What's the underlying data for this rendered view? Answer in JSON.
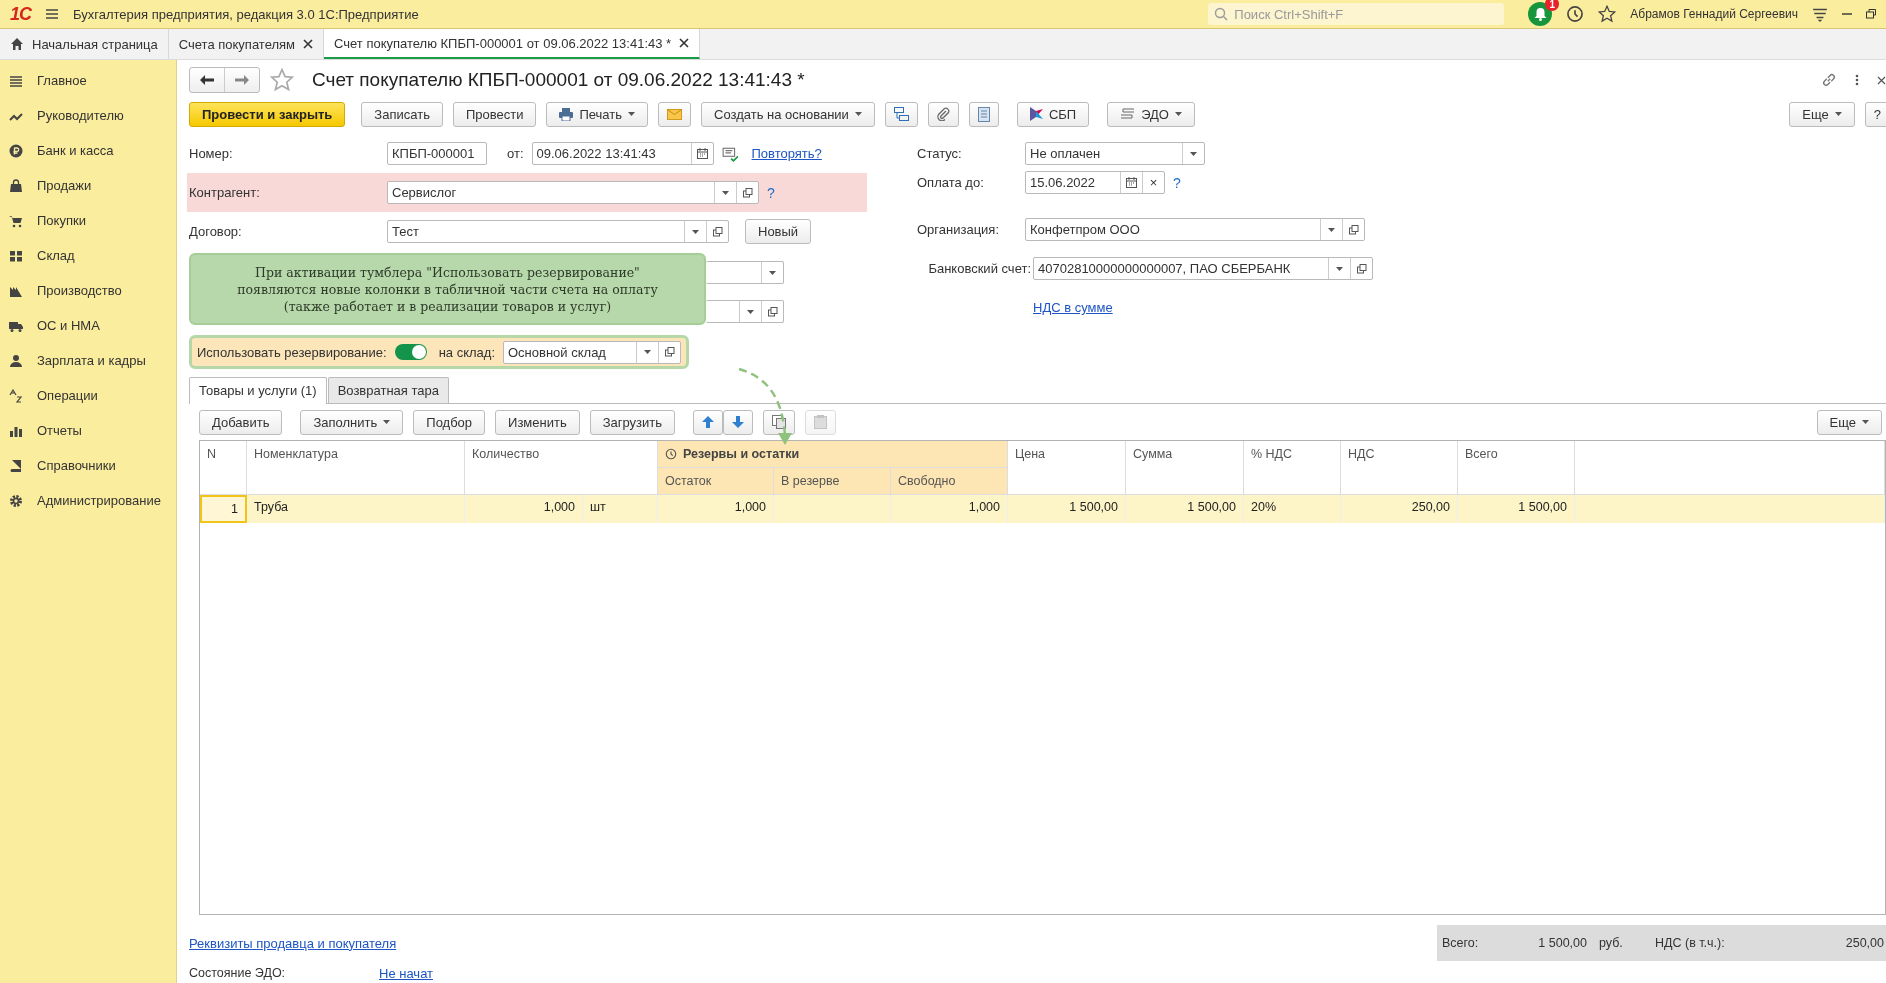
{
  "app_bar": {
    "logo": "1С",
    "title": "Бухгалтерия предприятия, редакция 3.0 1С:Предприятие",
    "search": {
      "placeholder": "Поиск Ctrl+Shift+F"
    },
    "notifications": "1",
    "user": "Абрамов Геннадий Сергеевич"
  },
  "open_tabs": [
    {
      "label": "Начальная страница",
      "kind": "home",
      "selected": false
    },
    {
      "label": "Счета покупателям",
      "kind": "closable",
      "selected": false
    },
    {
      "label": "Счет покупателю КПБП-000001 от 09.06.2022 13:41:43 *",
      "kind": "closable",
      "selected": true
    }
  ],
  "sidebar": {
    "items": [
      {
        "label": "Главное"
      },
      {
        "label": "Руководителю"
      },
      {
        "label": "Банк и касса"
      },
      {
        "label": "Продажи"
      },
      {
        "label": "Покупки"
      },
      {
        "label": "Склад"
      },
      {
        "label": "Производство"
      },
      {
        "label": "ОС и НМА"
      },
      {
        "label": "Зарплата и кадры"
      },
      {
        "label": "Операции"
      },
      {
        "label": "Отчеты"
      },
      {
        "label": "Справочники"
      },
      {
        "label": "Администрирование"
      }
    ]
  },
  "document": {
    "title": "Счет покупателю КПБП-000001 от 09.06.2022 13:41:43 *",
    "toolbar": [
      {
        "kind": "primary",
        "label": "Провести и закрыть"
      },
      {
        "kind": "button",
        "label": "Записать"
      },
      {
        "kind": "button",
        "label": "Провести"
      },
      {
        "kind": "print",
        "label": "Печать"
      },
      {
        "kind": "mail"
      },
      {
        "kind": "menu",
        "label": "Создать на основании"
      },
      {
        "kind": "structure"
      },
      {
        "kind": "clip"
      },
      {
        "kind": "list"
      },
      {
        "kind": "sbp",
        "label": "СБП"
      },
      {
        "kind": "edo",
        "label": "ЭДО"
      }
    ],
    "more_button": "Еще",
    "help_button": "?",
    "number": {
      "label": "Номер:",
      "value": "КПБП-000001",
      "date_label": "от:",
      "date": "09.06.2022 13:41:43",
      "repeat_link": "Повторять?"
    },
    "counterparty": {
      "label": "Контрагент:",
      "value": "Сервислог",
      "invalid": true,
      "help": "?"
    },
    "contract": {
      "label": "Договор:",
      "value": "Тест",
      "new_button": "Новый"
    },
    "callout": "При активации тумблера \"Использовать резервирование\" появляются новые колонки в табличной части счета на оплату (также работает и в реализации товаров и услуг)",
    "reservation": {
      "label": "Использовать резервирование:",
      "on": true,
      "warehouse_label": "на склад:",
      "warehouse": "Основной склад"
    },
    "status": {
      "label": "Статус:",
      "value": "Не оплачен"
    },
    "pay_until": {
      "label": "Оплата до:",
      "value": "15.06.2022",
      "clear": "×",
      "help": "?"
    },
    "organization": {
      "label": "Организация:",
      "value": "Конфетпром ООО"
    },
    "bank_account": {
      "label": "Банковский счет:",
      "value": "40702810000000000007, ПАО СБЕРБАНК"
    },
    "vat_link": "НДС в сумме"
  },
  "section_tabs": [
    {
      "label": "Товары и услуги (1)",
      "selected": true
    },
    {
      "label": "Возвратная тара",
      "selected": false
    }
  ],
  "table_toolbar": [
    {
      "kind": "button",
      "label": "Добавить",
      "disabled": false
    },
    {
      "kind": "menu",
      "label": "Заполнить",
      "disabled": false
    },
    {
      "kind": "button",
      "label": "Подбор",
      "disabled": false
    },
    {
      "kind": "button",
      "label": "Изменить",
      "disabled": false
    },
    {
      "kind": "button",
      "label": "Загрузить",
      "disabled": false
    },
    {
      "kind": "up",
      "disabled": false
    },
    {
      "kind": "down",
      "disabled": false
    },
    {
      "kind": "copy",
      "disabled": false
    },
    {
      "kind": "paste",
      "disabled": true
    }
  ],
  "table_more": "Еще",
  "table": {
    "columns": {
      "n": "N",
      "name": "Номенклатура",
      "qty": "Количество",
      "group": "Резервы и остатки",
      "remain": "Остаток",
      "reserved": "В резерве",
      "free": "Свободно",
      "price": "Цена",
      "sum": "Сумма",
      "vat_rate": "% НДС",
      "vat": "НДС",
      "total": "Всего"
    },
    "rows": [
      {
        "n": "1",
        "name": "Труба",
        "qty": "1,000",
        "unit": "шт",
        "remain": "1,000",
        "free": "1,000",
        "price": "1 500,00",
        "sum": "1 500,00",
        "vat_rate": "20%",
        "vat": "250,00",
        "total": "1 500,00",
        "selected": true
      }
    ]
  },
  "footer": {
    "details_link": "Реквизиты продавца и покупателя",
    "total_label": "Всего:",
    "total": "1 500,00",
    "currency": "руб.",
    "vat_label": "НДС (в т.ч.):",
    "vat": "250,00",
    "edo_label": "Состояние ЭДО:",
    "edo_value": "Не начат"
  }
}
